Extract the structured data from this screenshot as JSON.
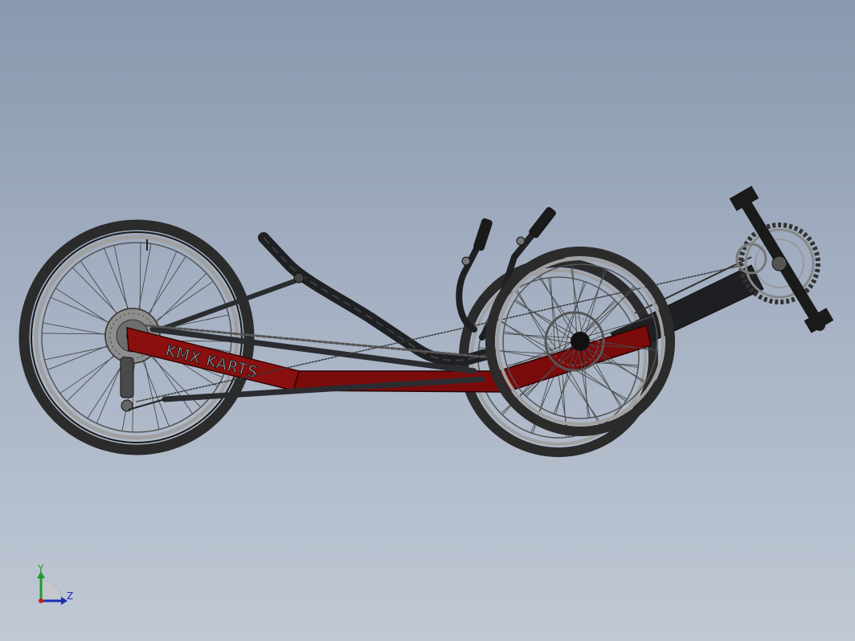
{
  "model": {
    "frame_lettering": "KMX KARTS",
    "frame_color": "#7a0b0b",
    "tire_color": "#2b2b2b",
    "rim_color": "#a0a0a0",
    "tube_color": "#2a2c30"
  },
  "view_triad": {
    "y_axis_label": "Y",
    "z_axis_label": "Z",
    "y_axis_color": "#1f9a2a",
    "z_axis_color": "#1b2fb0",
    "origin_color": "#c81e1e"
  },
  "viewport": {
    "background_top": "#8898ae",
    "background_bottom": "#c0c8d4"
  }
}
